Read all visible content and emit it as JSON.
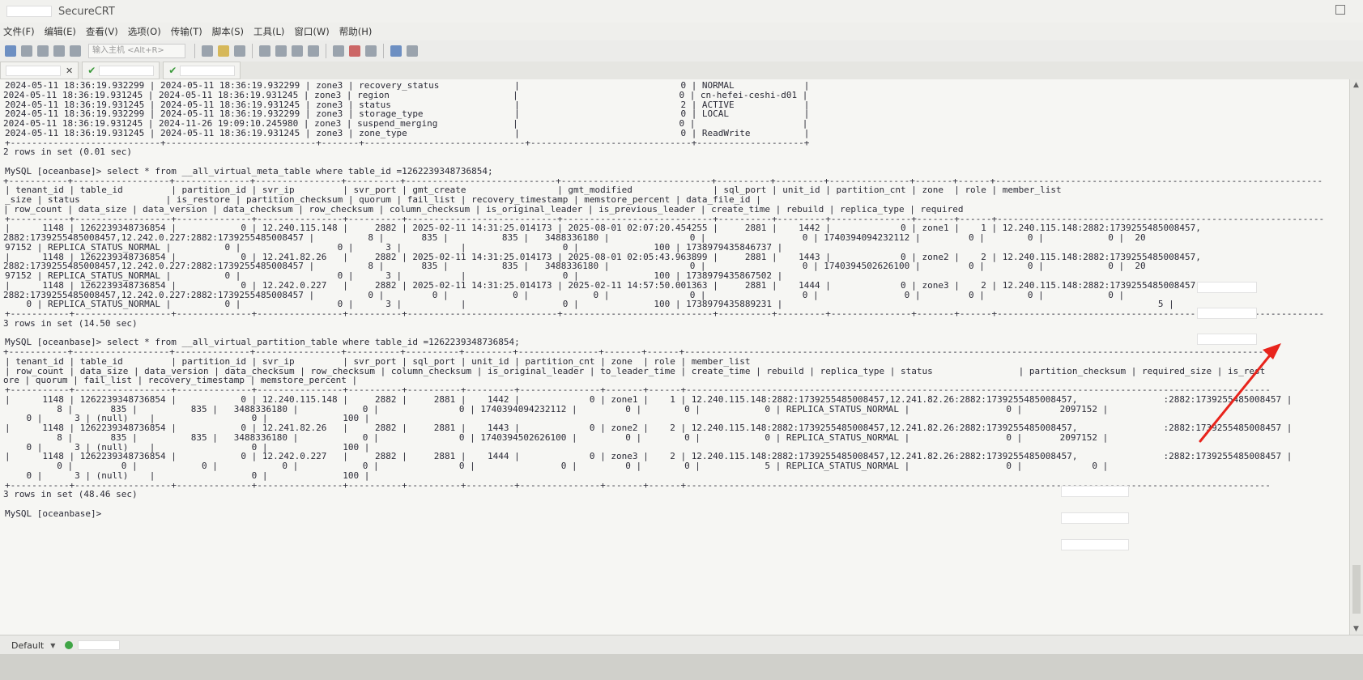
{
  "window": {
    "title": "SecureCRT"
  },
  "menu": [
    "文件(F)",
    "编辑(E)",
    "查看(V)",
    "选项(O)",
    "传输(T)",
    "脚本(S)",
    "工具(L)",
    "窗口(W)",
    "帮助(H)"
  ],
  "toolbar": {
    "host_placeholder": "输入主机 <Alt+R>"
  },
  "statusbar": {
    "session": "Default"
  },
  "annotation_color": "#e8241c",
  "terminal_lines": [
    "2024-05-11 18:36:19.932299 | 2024-05-11 18:36:19.932299 | zone3 | recovery_status              |                              0 | NORMAL             |",
    "2024-05-11 18:36:19.931245 | 2024-05-11 18:36:19.931245 | zone3 | region                       |                              0 | cn-hefei-ceshi-d01 |",
    "2024-05-11 18:36:19.931245 | 2024-05-11 18:36:19.931245 | zone3 | status                       |                              2 | ACTIVE             |",
    "2024-05-11 18:36:19.932299 | 2024-05-11 18:36:19.932299 | zone3 | storage_type                 |                              0 | LOCAL              |",
    "2024-05-11 18:36:19.931245 | 2024-11-26 19:09:10.245980 | zone3 | suspend_merging              |                              0 |                    |",
    "2024-05-11 18:36:19.931245 | 2024-05-11 18:36:19.931245 | zone3 | zone_type                    |                              0 | ReadWrite          |",
    "+----------------------------+----------------------------+-------+------------------------------+------------------------------+--------------------+",
    "2 rows in set (0.01 sec)",
    "",
    "MySQL [oceanbase]> select * from __all_virtual_meta_table where table_id =1262239348736854;",
    "+-----------+------------------+--------------+----------------+----------+----------------------------+----------------------------+----------+---------+---------------+-------+------+-------------------------------------------------------------",
    "| tenant_id | table_id         | partition_id | svr_ip         | svr_port | gmt_create                 | gmt_modified               | sql_port | unit_id | partition_cnt | zone  | role | member_list",
    "_size | status                | is_restore | partition_checksum | quorum | fail_list | recovery_timestamp | memstore_percent | data_file_id |",
    "| row_count | data_size | data_version | data_checksum | row_checksum | column_checksum | is_original_leader | is_previous_leader | create_time | rebuild | replica_type | required",
    "+-----------+------------------+--------------+----------------+----------+----------------------------+----------------------------+----------+---------+---------------+-------+------+-------------------------------------------------------------",
    "|      1148 | 1262239348736854 |            0 | 12.240.115.148 |     2882 | 2025-02-11 14:31:25.014173 | 2025-08-01 02:07:20.454255 |     2881 |    1442 |             0 | zone1 |    1 | 12.240.115.148:2882:1739255485008457,",
    "2882:1739255485008457,12.242.0.227:2882:1739255485008457 |          8 |       835 |          835 |   3488336180 |               0 |                  0 | 1740394094232112 |         0 |        0 |            0 |  20",
    "97152 | REPLICA_STATUS_NORMAL |          0 |                  0 |      3 |           |                  0 |              100 | 1738979435846737 |",
    "|      1148 | 1262239348736854 |            0 | 12.241.82.26   |     2882 | 2025-02-11 14:31:25.014173 | 2025-08-01 02:05:43.963899 |     2881 |    1443 |             0 | zone2 |    2 | 12.240.115.148:2882:1739255485008457,",
    "2882:1739255485008457,12.242.0.227:2882:1739255485008457 |          8 |       835 |          835 |   3488336180 |               0 |                  0 | 1740394502626100 |         0 |        0 |            0 |  20",
    "97152 | REPLICA_STATUS_NORMAL |          0 |                  0 |      3 |           |                  0 |              100 | 1738979435867502 |",
    "|      1148 | 1262239348736854 |            0 | 12.242.0.227   |     2882 | 2025-02-11 14:31:25.014173 | 2025-02-11 14:57:50.001363 |     2881 |    1444 |             0 | zone3 |    2 | 12.240.115.148:2882:1739255485008457,",
    "2882:1739255485008457,12.242.0.227:2882:1739255485008457 |          0 |         0 |            0 |            0 |               0 |                  0 |                0 |         0 |        0 |            0 |",
    "    0 | REPLICA_STATUS_NORMAL |          0 |                  0 |      3 |           |                  0 |              100 | 1738979435889231 |                                                                      5 |",
    "+-----------+------------------+--------------+----------------+----------+----------------------------+----------------------------+----------+---------+---------------+-------+------+-------------------------------------------------------------",
    "3 rows in set (14.50 sec)",
    "",
    "MySQL [oceanbase]> select * from __all_virtual_partition_table where table_id =1262239348736854;",
    "+-----------+------------------+--------------+----------------+----------+----------+---------+---------------+-------+------+-------------------------------------------------------------------------------------------------------------",
    "| tenant_id | table_id         | partition_id | svr_ip         | svr_port | sql_port | unit_id | partition_cnt | zone  | role | member_list",
    "| row_count | data_size | data_version | data_checksum | row_checksum | column_checksum | is_original_leader | to_leader_time | create_time | rebuild | replica_type | status                | partition_checksum | required_size | is_rest",
    "ore | quorum | fail_list | recovery_timestamp | memstore_percent |",
    "+-----------+------------------+--------------+----------------+----------+----------+---------+---------------+-------+------+-------------------------------------------------------------------------------------------------------------",
    "|      1148 | 1262239348736854 |            0 | 12.240.115.148 |     2882 |     2881 |    1442 |             0 | zone1 |    1 | 12.240.115.148:2882:1739255485008457,12.241.82.26:2882:1739255485008457,                :2882:1739255485008457 |",
    "          8 |       835 |          835 |   3488336180 |            0 |               0 | 1740394094232112 |         0 |        0 |            0 | REPLICA_STATUS_NORMAL |                  0 |       2097152 |",
    "    0 |      3 | (null)    |                  0 |              100 |",
    "|      1148 | 1262239348736854 |            0 | 12.241.82.26   |     2882 |     2881 |    1443 |             0 | zone2 |    2 | 12.240.115.148:2882:1739255485008457,12.241.82.26:2882:1739255485008457,                :2882:1739255485008457 |",
    "          8 |       835 |          835 |   3488336180 |            0 |               0 | 1740394502626100 |         0 |        0 |            0 | REPLICA_STATUS_NORMAL |                  0 |       2097152 |",
    "    0 |      3 | (null)    |                  0 |              100 |",
    "|      1148 | 1262239348736854 |            0 | 12.242.0.227   |     2882 |     2881 |    1444 |             0 | zone3 |    2 | 12.240.115.148:2882:1739255485008457,12.241.82.26:2882:1739255485008457,                :2882:1739255485008457 |",
    "          0 |         0 |            0 |            0 |            0 |               0 |                0 |         0 |        0 |            5 | REPLICA_STATUS_NORMAL |                  0 |             0 |",
    "    0 |      3 | (null)    |                  0 |              100 |",
    "+-----------+------------------+--------------+----------------+----------+----------+---------+---------------+-------+------+-------------------------------------------------------------------------------------------------------------",
    "3 rows in set (48.46 sec)",
    "",
    "MySQL [oceanbase]>"
  ]
}
